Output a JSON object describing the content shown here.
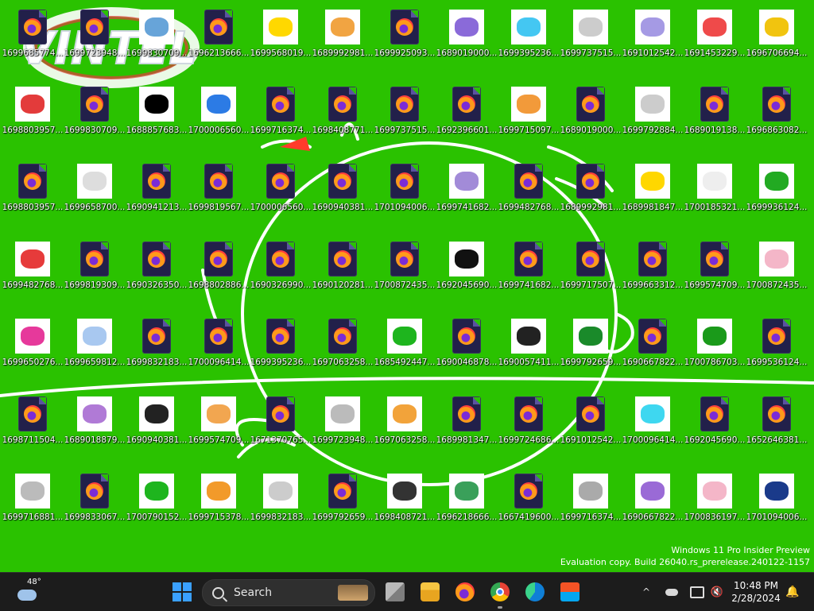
{
  "desktop": {
    "background_color": "#2ac200",
    "wallpaper_logo_text": "VINTEL",
    "icons": [
      {
        "label": "1699685774...",
        "type": "firefox"
      },
      {
        "label": "1699723948...",
        "type": "firefox"
      },
      {
        "label": "1699830709...",
        "type": "image",
        "color": "#67a4d9"
      },
      {
        "label": "1696213666...",
        "type": "firefox"
      },
      {
        "label": "1699568019...",
        "type": "image",
        "color": "#ffd800"
      },
      {
        "label": "1689992981...",
        "type": "image",
        "color": "#f1a442"
      },
      {
        "label": "1699925093...",
        "type": "firefox"
      },
      {
        "label": "1689019000...",
        "type": "image",
        "color": "#8a6ad9"
      },
      {
        "label": "1699395236...",
        "type": "image",
        "color": "#44c7f2"
      },
      {
        "label": "1699737515...",
        "type": "image",
        "color": "#cccccc"
      },
      {
        "label": "1691012542...",
        "type": "image",
        "color": "#a59ae4"
      },
      {
        "label": "1691453229...",
        "type": "image",
        "color": "#ef4a4a"
      },
      {
        "label": "1696706694...",
        "type": "image",
        "color": "#f1c40f"
      },
      {
        "label": "1698803957...",
        "type": "image",
        "color": "#e33b3b"
      },
      {
        "label": "1699830709...",
        "type": "firefox"
      },
      {
        "label": "1688857683...",
        "type": "image",
        "color": "#000000"
      },
      {
        "label": "1700006560...",
        "type": "image",
        "color": "#2c7be5"
      },
      {
        "label": "1699716374...",
        "type": "firefox"
      },
      {
        "label": "1698408771...",
        "type": "firefox"
      },
      {
        "label": "1699737515...",
        "type": "firefox"
      },
      {
        "label": "1692396601...",
        "type": "firefox"
      },
      {
        "label": "1699715097...",
        "type": "image",
        "color": "#f29a3a"
      },
      {
        "label": "1689019000...",
        "type": "firefox"
      },
      {
        "label": "1699792884...",
        "type": "image",
        "color": "#cccccc"
      },
      {
        "label": "1689019138...",
        "type": "firefox"
      },
      {
        "label": "1696863082...",
        "type": "firefox"
      },
      {
        "label": "1698803957...",
        "type": "firefox"
      },
      {
        "label": "1699658700...",
        "type": "image",
        "color": "#dddddd"
      },
      {
        "label": "1690941213...",
        "type": "firefox"
      },
      {
        "label": "1699819567...",
        "type": "firefox"
      },
      {
        "label": "1700006560...",
        "type": "firefox"
      },
      {
        "label": "1690940381...",
        "type": "firefox"
      },
      {
        "label": "1701094006...",
        "type": "firefox"
      },
      {
        "label": "1699741682...",
        "type": "image",
        "color": "#a28bd8"
      },
      {
        "label": "1699482768...",
        "type": "firefox"
      },
      {
        "label": "1689992981...",
        "type": "firefox"
      },
      {
        "label": "1689981847...",
        "type": "image",
        "color": "#ffd700"
      },
      {
        "label": "1700185321...",
        "type": "image",
        "color": "#eeeeee"
      },
      {
        "label": "1699936124...",
        "type": "image",
        "color": "#22aa22"
      },
      {
        "label": "1699482768...",
        "type": "image",
        "color": "#e63b3b"
      },
      {
        "label": "1699819309...",
        "type": "firefox"
      },
      {
        "label": "1690326350...",
        "type": "firefox"
      },
      {
        "label": "1698802886...",
        "type": "firefox"
      },
      {
        "label": "1690326990...",
        "type": "firefox"
      },
      {
        "label": "1690120281...",
        "type": "firefox"
      },
      {
        "label": "1700872435...",
        "type": "firefox"
      },
      {
        "label": "1692045690...",
        "type": "image",
        "color": "#111111"
      },
      {
        "label": "1699741682...",
        "type": "firefox"
      },
      {
        "label": "1699717507...",
        "type": "firefox"
      },
      {
        "label": "1699663312...",
        "type": "firefox"
      },
      {
        "label": "1699574709...",
        "type": "firefox"
      },
      {
        "label": "1700872435...",
        "type": "image",
        "color": "#f4b6c8"
      },
      {
        "label": "1699650276...",
        "type": "image",
        "color": "#e6399b"
      },
      {
        "label": "1699659812...",
        "type": "image",
        "color": "#a8c8f0"
      },
      {
        "label": "1699832183...",
        "type": "firefox"
      },
      {
        "label": "1700096414...",
        "type": "firefox"
      },
      {
        "label": "1699395236...",
        "type": "firefox"
      },
      {
        "label": "1697063258...",
        "type": "firefox"
      },
      {
        "label": "1685492447...",
        "type": "image",
        "color": "#1eb51e"
      },
      {
        "label": "1690046878...",
        "type": "firefox"
      },
      {
        "label": "1690057411...",
        "type": "image",
        "color": "#222222"
      },
      {
        "label": "1699792659...",
        "type": "image",
        "color": "#1a8a2a"
      },
      {
        "label": "1690667822...",
        "type": "firefox"
      },
      {
        "label": "1700786703...",
        "type": "image",
        "color": "#1a9a1a"
      },
      {
        "label": "1699536124...",
        "type": "firefox"
      },
      {
        "label": "1698711504...",
        "type": "firefox"
      },
      {
        "label": "1689018879...",
        "type": "image",
        "color": "#b07ad6"
      },
      {
        "label": "1690940381...",
        "type": "image",
        "color": "#222222"
      },
      {
        "label": "1699574709...",
        "type": "image",
        "color": "#f2a650"
      },
      {
        "label": "1671370765...",
        "type": "firefox"
      },
      {
        "label": "1699723948...",
        "type": "image",
        "color": "#bbbbbb"
      },
      {
        "label": "1697063258...",
        "type": "image",
        "color": "#f2a33a"
      },
      {
        "label": "1689981347...",
        "type": "firefox"
      },
      {
        "label": "1699724686...",
        "type": "firefox"
      },
      {
        "label": "1691012542...",
        "type": "firefox"
      },
      {
        "label": "1700096414...",
        "type": "image",
        "color": "#3ed7f0"
      },
      {
        "label": "1692045690...",
        "type": "firefox"
      },
      {
        "label": "1652646381...",
        "type": "firefox"
      },
      {
        "label": "1699716881...",
        "type": "image",
        "color": "#bbbbbb"
      },
      {
        "label": "1699833067...",
        "type": "firefox"
      },
      {
        "label": "1700790152...",
        "type": "image",
        "color": "#1eb51e"
      },
      {
        "label": "1699715378...",
        "type": "image",
        "color": "#f29a2a"
      },
      {
        "label": "1699832183...",
        "type": "image",
        "color": "#cccccc"
      },
      {
        "label": "1699792659...",
        "type": "firefox"
      },
      {
        "label": "1698408721...",
        "type": "image",
        "color": "#333333"
      },
      {
        "label": "1696218666...",
        "type": "image",
        "color": "#3aa05a"
      },
      {
        "label": "1667419600...",
        "type": "firefox"
      },
      {
        "label": "1699716374...",
        "type": "image",
        "color": "#aaaaaa"
      },
      {
        "label": "1690667822...",
        "type": "image",
        "color": "#9a6ad6"
      },
      {
        "label": "1700836197...",
        "type": "image",
        "color": "#f4b6c8"
      },
      {
        "label": "1701094006...",
        "type": "image",
        "color": "#1a3a8a"
      }
    ]
  },
  "watermark": {
    "line1": "Windows 11 Pro Insider Preview",
    "line2": "Evaluation copy. Build 26040.rs_prerelease.240122-1157"
  },
  "taskbar": {
    "weather_temp": "48°",
    "search_placeholder": "Search",
    "clock_time": "10:48 PM",
    "clock_date": "2/28/2024",
    "tray_chevron": "^",
    "apps": [
      "task-view",
      "file-explorer",
      "firefox",
      "chrome",
      "edge",
      "microsoft-store"
    ],
    "accent_color": "#3aa0ff"
  }
}
